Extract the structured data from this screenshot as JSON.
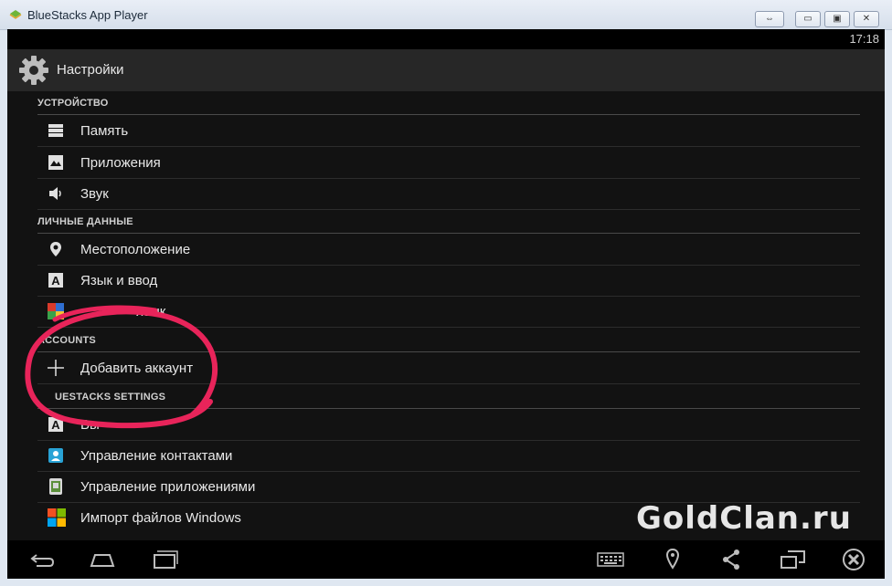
{
  "window": {
    "title": "BlueStacks App Player"
  },
  "status": {
    "time": "17:18"
  },
  "actionbar": {
    "title": "Настройки"
  },
  "sections": {
    "device": "УСТРОЙСТВО",
    "personal": "ЛИЧНЫЕ ДАННЫЕ",
    "accounts": "ACCOUNTS",
    "bluestacks": "UESTACKS SETTINGS"
  },
  "items": {
    "memory": "Память",
    "apps": "Приложения",
    "sound": "Звук",
    "location": "Местоположение",
    "language_input": "Язык и ввод",
    "change_language": "язык",
    "add_account": "Добавить аккаунт",
    "keyboard": "Вы",
    "contacts": "Управление контактами",
    "app_manager": "Управление приложениями",
    "import_windows": "Импорт файлов Windows"
  },
  "watermark": "GoldClan.ru",
  "colors": {
    "annotation": "#e8245a",
    "windows_blue": "#00a4ef",
    "windows_red": "#f25022",
    "windows_green": "#7fba00",
    "windows_yellow": "#ffb900"
  }
}
